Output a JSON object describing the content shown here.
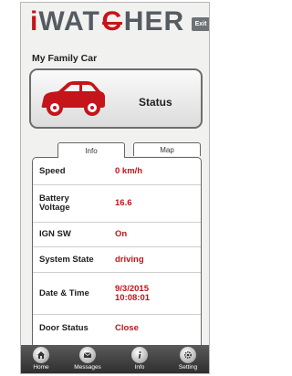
{
  "app": {
    "logo_prefix": "i",
    "logo_main_1": "WAT",
    "logo_c": "C",
    "logo_main_2": "HER",
    "exit_label": "Exit"
  },
  "vehicle": {
    "name": "My Family Car"
  },
  "status_card": {
    "label": "Status",
    "icon": "car-icon",
    "icon_color": "#c5141a"
  },
  "tabs": [
    {
      "label": "Info",
      "active": true
    },
    {
      "label": "Map",
      "active": false
    }
  ],
  "info": {
    "rows": [
      {
        "label": "Speed",
        "value": "0 km/h"
      },
      {
        "label": "Battery Voltage",
        "value": "16.6"
      },
      {
        "label": "IGN SW",
        "value": "On"
      },
      {
        "label": "System State",
        "value": "driving"
      },
      {
        "label": "Date & Time",
        "value": "9/3/2015 10:08:01"
      },
      {
        "label": "Door Status",
        "value": "Close"
      }
    ]
  },
  "tabbar": {
    "items": [
      {
        "label": "Home",
        "icon": "home-icon"
      },
      {
        "label": "Messages",
        "icon": "messages-icon"
      },
      {
        "label": "Info",
        "icon": "info-icon"
      },
      {
        "label": "Setting",
        "icon": "settings-icon"
      }
    ]
  },
  "colors": {
    "accent": "#c5141a",
    "value_text": "#c0141c",
    "logo_grey": "#555b61",
    "tabbar_bg": "#3a3a3a"
  }
}
